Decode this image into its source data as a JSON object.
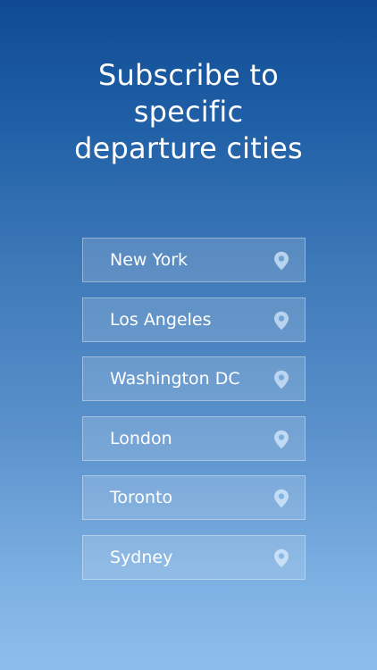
{
  "headline": {
    "line1": "Subscribe to",
    "line2": "specific",
    "line3": "departure cities"
  },
  "cities": [
    {
      "label": "New York",
      "icon": "location-pin-icon"
    },
    {
      "label": "Los Angeles",
      "icon": "location-pin-icon"
    },
    {
      "label": "Washington DC",
      "icon": "location-pin-icon"
    },
    {
      "label": "London",
      "icon": "location-pin-icon"
    },
    {
      "label": "Toronto",
      "icon": "location-pin-icon"
    },
    {
      "label": "Sydney",
      "icon": "location-pin-icon"
    }
  ],
  "colors": {
    "background_top": "#0f4a92",
    "background_bottom": "#8cbdec",
    "text": "#ffffff",
    "pin": "#b9d3ef"
  }
}
